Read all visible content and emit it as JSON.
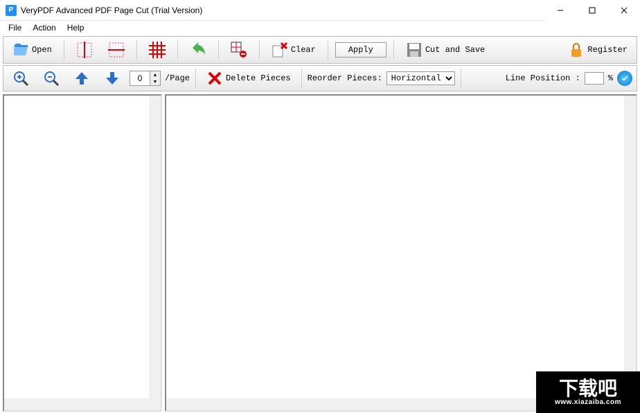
{
  "window": {
    "title": "VeryPDF Advanced PDF Page Cut (Trial Version)"
  },
  "menu": {
    "file": "File",
    "action": "Action",
    "help": "Help"
  },
  "toolbar1": {
    "open": "Open",
    "clear": "Clear",
    "apply": "Apply",
    "cutsave": "Cut and Save",
    "register": "Register"
  },
  "toolbar2": {
    "page_value": "0",
    "page_suffix": "/Page",
    "delete_pieces": "Delete Pieces",
    "reorder_label": "Reorder Pieces:",
    "reorder_value": "Horizontal",
    "lineposition_label": "Line Position :",
    "lineposition_pct": "%"
  },
  "watermark": {
    "text": "下载吧",
    "url": "www.xiazaiba.com"
  }
}
